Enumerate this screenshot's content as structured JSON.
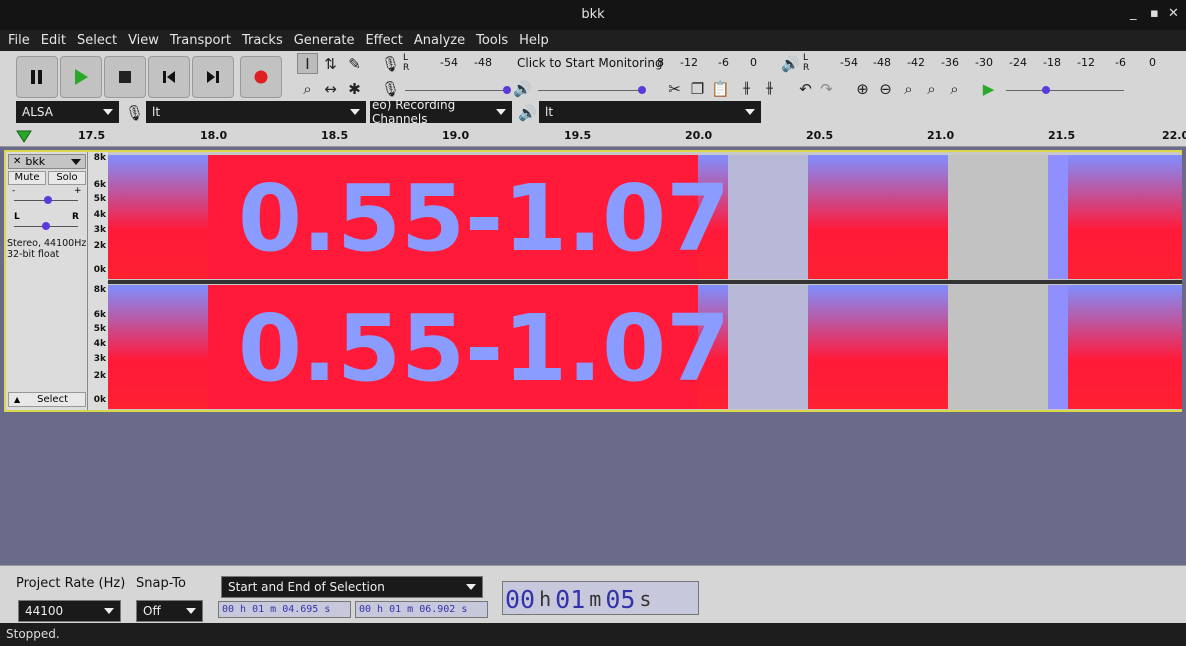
{
  "window": {
    "title": "bkk",
    "controls": [
      "_",
      "▪",
      "✕"
    ]
  },
  "menu": [
    "File",
    "Edit",
    "Select",
    "View",
    "Transport",
    "Tracks",
    "Generate",
    "Effect",
    "Analyze",
    "Tools",
    "Help"
  ],
  "meters": {
    "record_labels": [
      "-54",
      "-48"
    ],
    "record_prompt": "Click to Start Monitoring",
    "record_labels_right": [
      "8",
      "-12",
      "-6",
      "0"
    ],
    "play_labels": [
      "-54",
      "-48",
      "-42",
      "-36",
      "-30",
      "-24",
      "-18",
      "-12",
      "-6",
      "0"
    ],
    "lr": [
      "L",
      "R"
    ]
  },
  "devices": {
    "host": "ALSA",
    "input": "lt",
    "channels": "eo) Recording Channels",
    "output": "lt"
  },
  "ruler": {
    "ticks": [
      "17.5",
      "18.0",
      "18.5",
      "19.0",
      "19.5",
      "20.0",
      "20.5",
      "21.0",
      "21.5",
      "22.0"
    ]
  },
  "track": {
    "name": "bkk",
    "mute": "Mute",
    "solo": "Solo",
    "gain_minus": "-",
    "gain_plus": "+",
    "pan_l": "L",
    "pan_r": "R",
    "info_line1": "Stereo, 44100Hz",
    "info_line2": "32-bit float",
    "select": "Select",
    "scale_labels": [
      "8k",
      "6k",
      "5k",
      "4k",
      "3k",
      "2k",
      "0k"
    ],
    "spectrogram_text": "0.55-1.07"
  },
  "bottom": {
    "project_rate_label": "Project Rate (Hz)",
    "project_rate_value": "44100",
    "snap_label": "Snap-To",
    "snap_value": "Off",
    "selection_mode": "Start and End of Selection",
    "sel_start": "00 h 01 m 04.695 s",
    "sel_end": "00 h 01 m 06.902 s",
    "position_h": "00",
    "position_m": "01",
    "position_s": "05",
    "unit_h": "h",
    "unit_m": "m",
    "unit_s": "s"
  },
  "status": "Stopped.",
  "colors": {
    "selection_border": "#d8d84a",
    "spectro_red": "#ff1a3a",
    "spectro_blue": "#7f8fff",
    "record": "#e02020",
    "play": "#29a829"
  }
}
